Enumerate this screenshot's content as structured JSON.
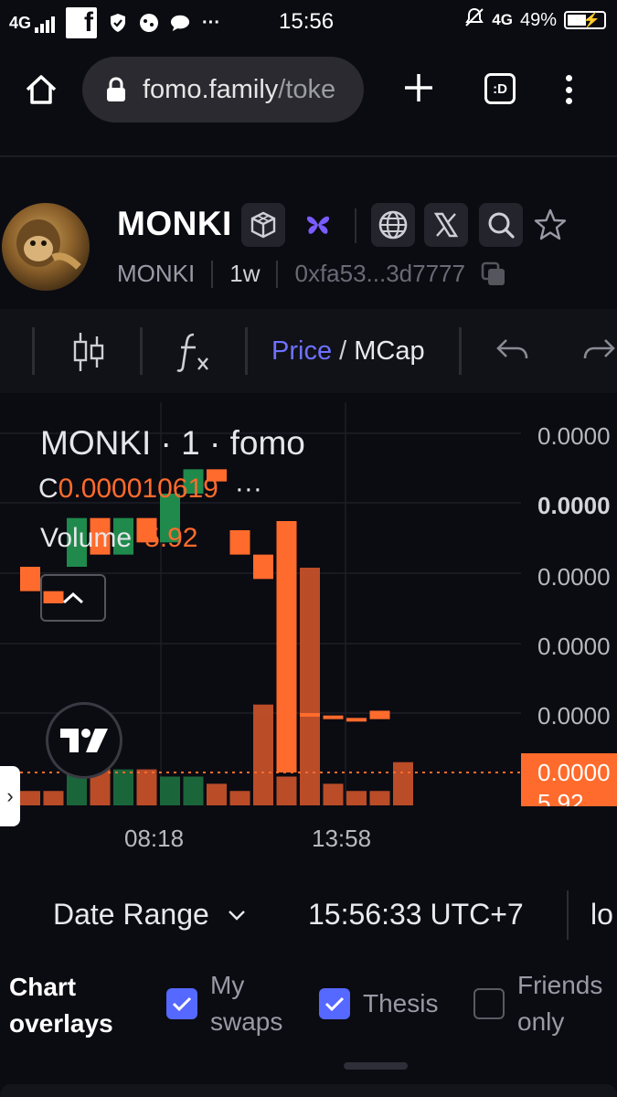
{
  "status_bar": {
    "network_left": "4G",
    "time": "15:56",
    "network_right": "4G",
    "battery": "49%",
    "fb_letter": "f"
  },
  "browser": {
    "url_main": "fomo.family",
    "url_path": "/toke",
    "tabs_label": ":D"
  },
  "token": {
    "name": "MONKI",
    "symbol": "MONKI",
    "age": "1w",
    "address": "0xfa53...3d7777"
  },
  "toolbar": {
    "price_label": "Price",
    "slash": "/",
    "mcap_label": "MCap"
  },
  "chart_legend": {
    "title": "MONKI · 1 · fomo",
    "close_prefix": "C",
    "close_value": "0.000010619",
    "dots": "···",
    "volume_label": "Volume",
    "volume_value": "5.92"
  },
  "price_axis": {
    "labels": [
      "0.0000",
      "0.0000",
      "0.0000",
      "0.0000",
      "0.0000"
    ],
    "current_price_tag": "0.0000",
    "below_tag": "5.92"
  },
  "time_axis": [
    "08:18",
    "13:58"
  ],
  "chart_data": {
    "type": "candlestick",
    "title": "MONKI · 1 · fomo",
    "colors": {
      "up": "#1f8a4c",
      "down": "#ff6b2c",
      "volume_up": "#1b6b3d",
      "volume_down": "#c4502a"
    },
    "last_close": 1.0619e-05,
    "last_volume": 5.92,
    "candles": [
      {
        "open": 1.18e-05,
        "close": 1.16e-05,
        "dir": "down"
      },
      {
        "open": 1.16e-05,
        "close": 1.15e-05,
        "dir": "down"
      },
      {
        "open": 1.18e-05,
        "close": 1.22e-05,
        "dir": "up"
      },
      {
        "open": 1.22e-05,
        "close": 1.19e-05,
        "dir": "down"
      },
      {
        "open": 1.19e-05,
        "close": 1.22e-05,
        "dir": "up"
      },
      {
        "open": 1.22e-05,
        "close": 1.2e-05,
        "dir": "down"
      },
      {
        "open": 1.2e-05,
        "close": 1.24e-05,
        "dir": "up"
      },
      {
        "open": 1.24e-05,
        "close": 1.26e-05,
        "dir": "up"
      },
      {
        "open": 1.26e-05,
        "close": 1.25e-05,
        "dir": "down"
      },
      {
        "open": 1.21e-05,
        "close": 1.19e-05,
        "dir": "down"
      },
      {
        "open": 1.19e-05,
        "close": 1.17e-05,
        "dir": "down"
      },
      {
        "open": 1.16e-05,
        "close": 1.06e-05,
        "dir": "down"
      },
      {
        "open": 1.06e-05,
        "close": 1.058e-05,
        "dir": "down"
      },
      {
        "open": 1.058e-05,
        "close": 1.056e-05,
        "dir": "down"
      },
      {
        "open": 1.056e-05,
        "close": 1.055e-05,
        "dir": "down"
      },
      {
        "open": 1.055e-05,
        "close": 1.0619e-05,
        "dir": "down"
      }
    ],
    "volume": [
      0.2,
      0.2,
      1.1,
      1.0,
      0.5,
      0.5,
      0.4,
      0.4,
      0.3,
      0.2,
      1.4,
      0.4,
      3.3,
      0.3,
      0.2,
      0.2,
      0.6
    ],
    "volume_dir": [
      "down",
      "down",
      "up",
      "down",
      "up",
      "down",
      "up",
      "up",
      "down",
      "down",
      "down",
      "down",
      "down",
      "down",
      "down",
      "down",
      "down"
    ],
    "ylim": [
      1e-05,
      1.3e-05
    ],
    "xlabels": [
      "08:18",
      "13:58"
    ]
  },
  "range_row": {
    "date_range_label": "Date Range",
    "tz_time": "15:56:33 UTC+7",
    "log_label": "lo"
  },
  "overlays": {
    "title": "Chart overlays",
    "options": [
      {
        "label": "My swaps",
        "checked": true
      },
      {
        "label": "Thesis",
        "checked": true
      },
      {
        "label": "Friends only",
        "checked": false
      }
    ]
  }
}
